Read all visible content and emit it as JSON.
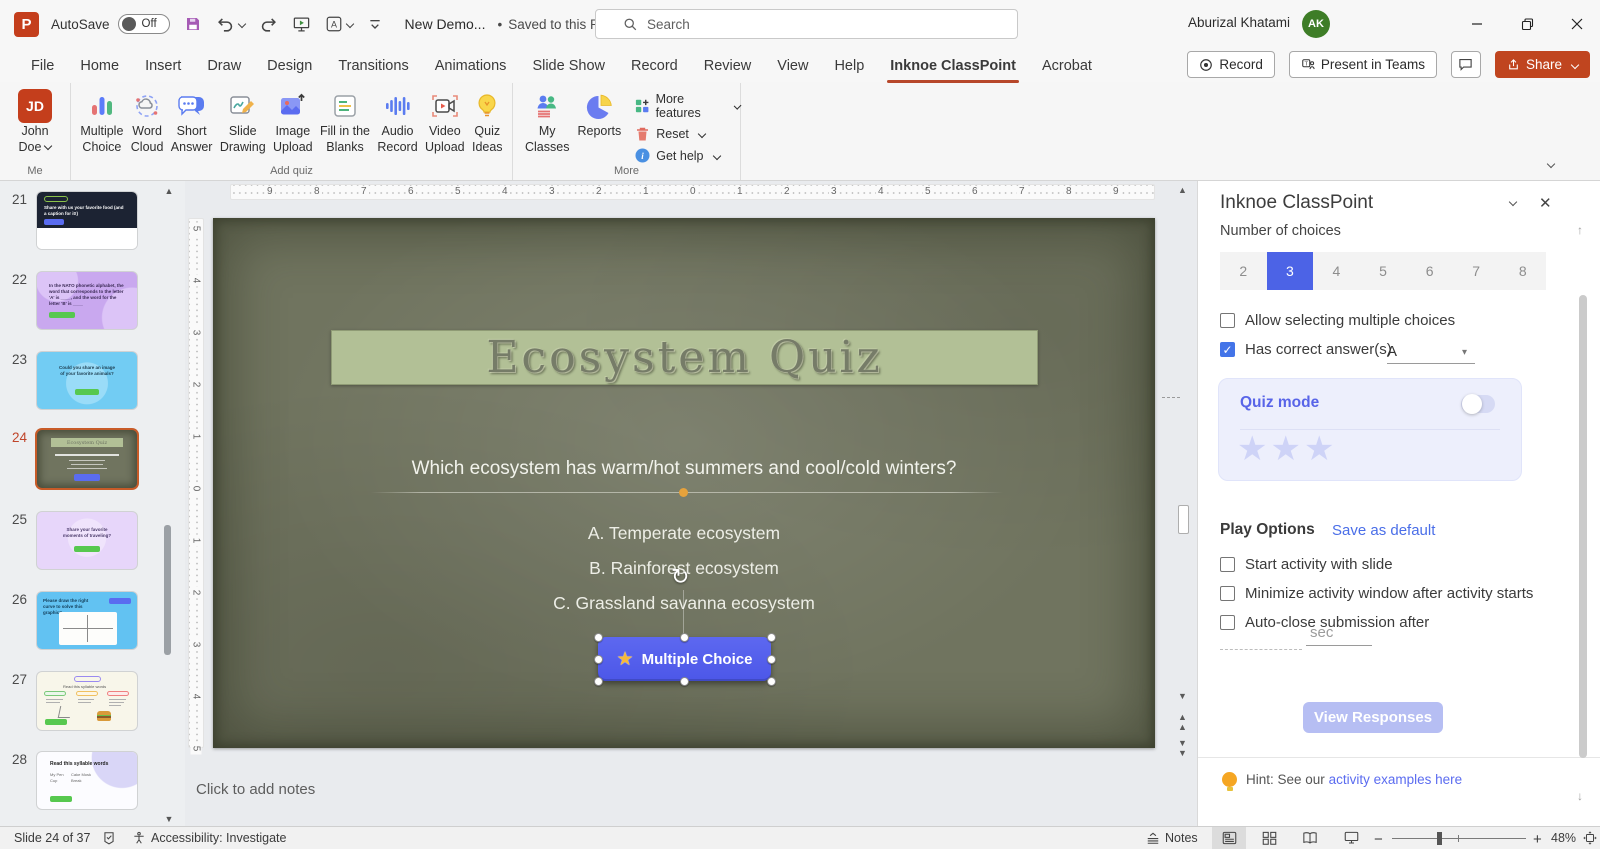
{
  "titlebar": {
    "autosave_label": "AutoSave",
    "autosave_state": "Off",
    "filename": "New Demo...",
    "bullet": "•",
    "saved_status": "Saved to this PC",
    "search_placeholder": "Search",
    "user_name": "Aburizal Khatami",
    "user_initials": "AK"
  },
  "tabs": {
    "items": [
      "File",
      "Home",
      "Insert",
      "Draw",
      "Design",
      "Transitions",
      "Animations",
      "Slide Show",
      "Record",
      "Review",
      "View",
      "Help",
      "Inknoe ClassPoint",
      "Acrobat"
    ],
    "record_button": "Record",
    "present_button": "Present in Teams",
    "share_button": "Share"
  },
  "ribbon": {
    "me": {
      "initials": "JD",
      "line1": "John",
      "line2": "Doe",
      "group_label": "Me"
    },
    "add_quiz": {
      "group_label": "Add quiz",
      "items": [
        {
          "l1": "Multiple",
          "l2": "Choice"
        },
        {
          "l1": "Word",
          "l2": "Cloud"
        },
        {
          "l1": "Short",
          "l2": "Answer"
        },
        {
          "l1": "Slide",
          "l2": "Drawing"
        },
        {
          "l1": "Image",
          "l2": "Upload"
        },
        {
          "l1": "Fill in the",
          "l2": "Blanks"
        },
        {
          "l1": "Audio",
          "l2": "Record"
        },
        {
          "l1": "Video",
          "l2": "Upload"
        },
        {
          "l1": "Quiz",
          "l2": "Ideas"
        }
      ]
    },
    "more": {
      "group_label": "More",
      "my_classes_l1": "My",
      "my_classes_l2": "Classes",
      "reports": "Reports",
      "small_items": [
        "More features",
        "Reset",
        "Get help"
      ]
    }
  },
  "thumbnails": {
    "items": [
      {
        "number": "21",
        "text": "Share with us your favorite food (and a caption for it!)"
      },
      {
        "number": "22",
        "text": "In the NATO phonetic alphabet, the word that corresponds to the letter 'A' is ____, and the word for the letter 'B' is ____"
      },
      {
        "number": "23",
        "text": "Could you share an image of your favorite animals?"
      },
      {
        "number": "24",
        "text": "Ecosystem Quiz"
      },
      {
        "number": "25",
        "text": "Share your favorite moments of traveling?"
      },
      {
        "number": "26",
        "text": "Please draw the right curve to solve this graphic?"
      },
      {
        "number": "27",
        "text": "Read this syllable words"
      },
      {
        "number": "28",
        "text": "Read this syllable words",
        "col1": "My Pen Cup",
        "col2": "Cake Mosk Break"
      }
    ]
  },
  "rulers": {
    "horizontal": [
      "9",
      "8",
      "7",
      "6",
      "5",
      "4",
      "3",
      "2",
      "1",
      "0",
      "1",
      "2",
      "3",
      "4",
      "5",
      "6",
      "7",
      "8",
      "9"
    ],
    "vertical": [
      "5",
      "4",
      "3",
      "2",
      "1",
      "0",
      "1",
      "2",
      "3",
      "4",
      "5"
    ]
  },
  "slide": {
    "title": "Ecosystem Quiz",
    "question": "Which ecosystem has warm/hot summers and cool/cold winters?",
    "options": [
      "A. Temperate ecosystem",
      "B. Rainforest ecosystem",
      "C. Grassland savanna ecosystem"
    ],
    "button_label": "Multiple Choice",
    "rotate_glyph": "↻",
    "star_glyph": "★"
  },
  "notes": {
    "placeholder": "Click to add notes"
  },
  "panel": {
    "title": "Inknoe ClassPoint",
    "number_of_choices_label": "Number of choices",
    "choices": [
      "2",
      "3",
      "4",
      "5",
      "6",
      "7",
      "8"
    ],
    "selected_choice": "3",
    "allow_multiple_label": "Allow selecting multiple choices",
    "has_correct_label": "Has correct answer(s)",
    "correct_answer_value": "A",
    "quiz_mode_label": "Quiz mode",
    "stars_glyphs": "★★★",
    "play_options_label": "Play Options",
    "save_default_label": "Save as default",
    "cb_start": "Start activity with slide",
    "cb_minimize": "Minimize activity window after activity starts",
    "cb_autoclose": "Auto-close submission after",
    "sec_label": "sec",
    "view_responses_label": "View Responses",
    "hint_prefix": "Hint: See our",
    "hint_link": "activity examples here",
    "accent_color": "#4c63e6"
  },
  "statusbar": {
    "slide_info": "Slide 24 of 37",
    "accessibility": "Accessibility: Investigate",
    "notes_label": "Notes",
    "zoom_level": "48%"
  }
}
